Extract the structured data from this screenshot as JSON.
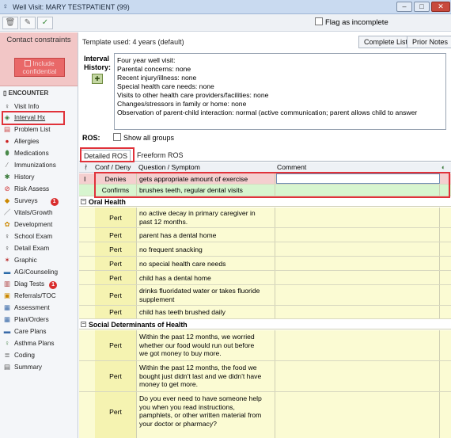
{
  "window": {
    "title": "Well Visit: MARY TESTPATIENT (99)",
    "min": "–",
    "max": "□",
    "close": "✕"
  },
  "toolbar": {
    "flag_label": "Flag as incomplete"
  },
  "sidebar": {
    "contact_title": "Contact constraints",
    "include_label": "Include confidential",
    "encounter_label": "ENCOUNTER",
    "items": [
      {
        "label": "Visit Info"
      },
      {
        "label": "Interval Hx"
      },
      {
        "label": "Problem List"
      },
      {
        "label": "Allergies"
      },
      {
        "label": "Medications"
      },
      {
        "label": "Immunizations"
      },
      {
        "label": "History"
      },
      {
        "label": "Risk Assess"
      },
      {
        "label": "Surveys",
        "badge": "1"
      },
      {
        "label": "Vitals/Growth"
      },
      {
        "label": "Development"
      },
      {
        "label": "School Exam"
      },
      {
        "label": "Detail Exam"
      },
      {
        "label": "Graphic"
      },
      {
        "label": "AG/Counseling"
      },
      {
        "label": "Diag Tests",
        "badge": "1"
      },
      {
        "label": "Referrals/TOC"
      },
      {
        "label": "Assessment"
      },
      {
        "label": "Plan/Orders"
      },
      {
        "label": "Care Plans"
      },
      {
        "label": "Asthma Plans"
      },
      {
        "label": "Coding"
      },
      {
        "label": "Summary"
      }
    ]
  },
  "template": {
    "text": "Template used:  4 years (default)"
  },
  "buttons": {
    "complete_list": "Complete List",
    "prior_notes": "Prior Notes"
  },
  "interval": {
    "label1": "Interval",
    "label2": "History:",
    "lines": [
      "Four year well visit:",
      "Parental concerns: none",
      "Recent injury/illness: none",
      "Special health care needs:  none",
      "Visits to other health care providers/facilities:  none",
      "Changes/stressors in family or home: none",
      "Observation of parent-child interaction: normal (active communication; parent allows child to answer"
    ]
  },
  "ros": {
    "label": "ROS:",
    "show_all": "Show all groups"
  },
  "tabs": {
    "detailed": "Detailed ROS",
    "freeform": "Freeform ROS"
  },
  "grid": {
    "col_conf": "Conf / Deny",
    "col_q": "Question / Symptom",
    "col_comment": "Comment",
    "top_rows": [
      {
        "conf": "Denies",
        "q": "gets appropriate amount of exercise"
      },
      {
        "conf": "Confirms",
        "q": "brushes teeth, regular dental visits"
      }
    ],
    "oral_title": "Oral Health",
    "oral_rows": [
      {
        "conf": "Pert",
        "q1": "no active decay in primary caregiver in",
        "q2": "past 12 months."
      },
      {
        "conf": "Pert",
        "q1": "parent has a dental home"
      },
      {
        "conf": "Pert",
        "q1": "no frequent snacking"
      },
      {
        "conf": "Pert",
        "q1": "no special health care needs"
      },
      {
        "conf": "Pert",
        "q1": "child has a dental home"
      },
      {
        "conf": "Pert",
        "q1": "drinks fluoridated water or takes fluoride",
        "q2": "supplement"
      },
      {
        "conf": "Pert",
        "q1": "child has teeth brushed daily"
      }
    ],
    "sdoh_title": "Social Determinants of Health",
    "sdoh_rows": [
      {
        "conf": "Pert",
        "lines": [
          "Within the past 12 months, we worried",
          "whether our food would run out before",
          "we got money to buy more."
        ]
      },
      {
        "conf": "Pert",
        "lines": [
          "Within the past 12 months, the food we",
          "bought just didn't last and we didn't have",
          "money to get more."
        ]
      },
      {
        "conf": "Pert",
        "lines": [
          "Do you ever need to have someone help",
          "you when you read instructions,",
          "pamphlets, or other written material from",
          "your doctor or pharmacy?"
        ]
      }
    ]
  }
}
